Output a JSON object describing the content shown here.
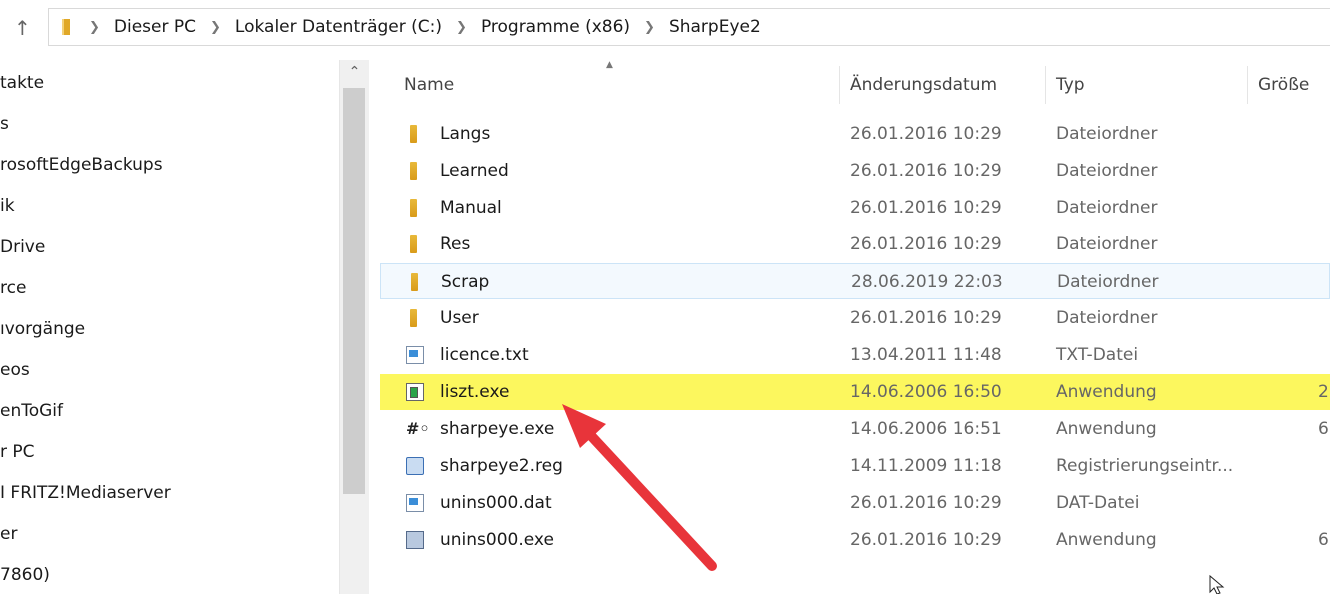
{
  "address": {
    "crumbs": [
      "Dieser PC",
      "Lokaler Datenträger (C:)",
      "Programme (x86)",
      "SharpEye2"
    ]
  },
  "nav": {
    "items": [
      "takte",
      "s",
      "rosoftEdgeBackups",
      "ik",
      "Drive",
      "rce",
      "ıvorgänge",
      "eos",
      "enToGif",
      "r PC",
      "I FRITZ!Mediaserver",
      "er",
      "7860)"
    ]
  },
  "columns": {
    "name": "Name",
    "date": "Änderungsdatum",
    "type": "Typ",
    "size": "Größe"
  },
  "files": [
    {
      "name": "Langs",
      "date": "26.01.2016 10:29",
      "type": "Dateiordner",
      "size": "",
      "icon": "folder-icon"
    },
    {
      "name": "Learned",
      "date": "26.01.2016 10:29",
      "type": "Dateiordner",
      "size": "",
      "icon": "folder-icon"
    },
    {
      "name": "Manual",
      "date": "26.01.2016 10:29",
      "type": "Dateiordner",
      "size": "",
      "icon": "folder-icon"
    },
    {
      "name": "Res",
      "date": "26.01.2016 10:29",
      "type": "Dateiordner",
      "size": "",
      "icon": "folder-icon"
    },
    {
      "name": "Scrap",
      "date": "28.06.2019 22:03",
      "type": "Dateiordner",
      "size": "",
      "icon": "folder-icon"
    },
    {
      "name": "User",
      "date": "26.01.2016 10:29",
      "type": "Dateiordner",
      "size": "",
      "icon": "folder-icon"
    },
    {
      "name": "licence.txt",
      "date": "13.04.2011 11:48",
      "type": "TXT-Datei",
      "size": "",
      "icon": "text-file-icon"
    },
    {
      "name": "liszt.exe",
      "date": "14.06.2006 16:50",
      "type": "Anwendung",
      "size": "2",
      "icon": "application-icon"
    },
    {
      "name": "sharpeye.exe",
      "date": "14.06.2006 16:51",
      "type": "Anwendung",
      "size": "6",
      "icon": "sharpeye-icon"
    },
    {
      "name": "sharpeye2.reg",
      "date": "14.11.2009 11:18",
      "type": "Registrierungseintr...",
      "size": "",
      "icon": "registry-icon"
    },
    {
      "name": "unins000.dat",
      "date": "26.01.2016 10:29",
      "type": "DAT-Datei",
      "size": "",
      "icon": "dat-file-icon"
    },
    {
      "name": "unins000.exe",
      "date": "26.01.2016 10:29",
      "type": "Anwendung",
      "size": "6",
      "icon": "uninstaller-icon"
    }
  ],
  "colors": {
    "highlight": "#fcf75e",
    "hover_border": "#cce4f7",
    "arrow": "#e8343a",
    "folder": "#e0a828"
  }
}
